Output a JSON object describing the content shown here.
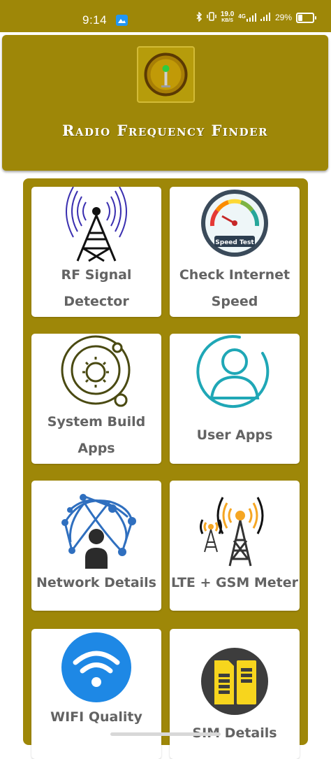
{
  "status_bar": {
    "time": "9:14",
    "net_speed_value": "19.0",
    "net_speed_unit": "KB/S",
    "network_type": "4G",
    "battery_percent": "29%",
    "battery_level": 0.29
  },
  "header": {
    "title": "Radio Frequency Finder",
    "logo_icon": "rf-antenna-logo-icon"
  },
  "colors": {
    "primary": "#9e8708",
    "card": "#ffffff",
    "label": "#636363"
  },
  "menu": {
    "items": [
      {
        "label": "RF Signal\nDetector",
        "icon": "radio-tower-icon"
      },
      {
        "label": "Check Internet\nSpeed",
        "icon": "speed-test-icon",
        "icon_text": "Speed Test"
      },
      {
        "label": "System Build\nApps",
        "icon": "system-orbit-icon"
      },
      {
        "label": "User Apps",
        "icon": "user-icon"
      },
      {
        "label": "Network Details",
        "icon": "network-globe-icon"
      },
      {
        "label": "LTE + GSM Meter",
        "icon": "cell-towers-icon"
      },
      {
        "label": "WIFI Quality",
        "icon": "wifi-icon"
      },
      {
        "label": "SIM Details",
        "icon": "sim-card-icon"
      }
    ]
  }
}
